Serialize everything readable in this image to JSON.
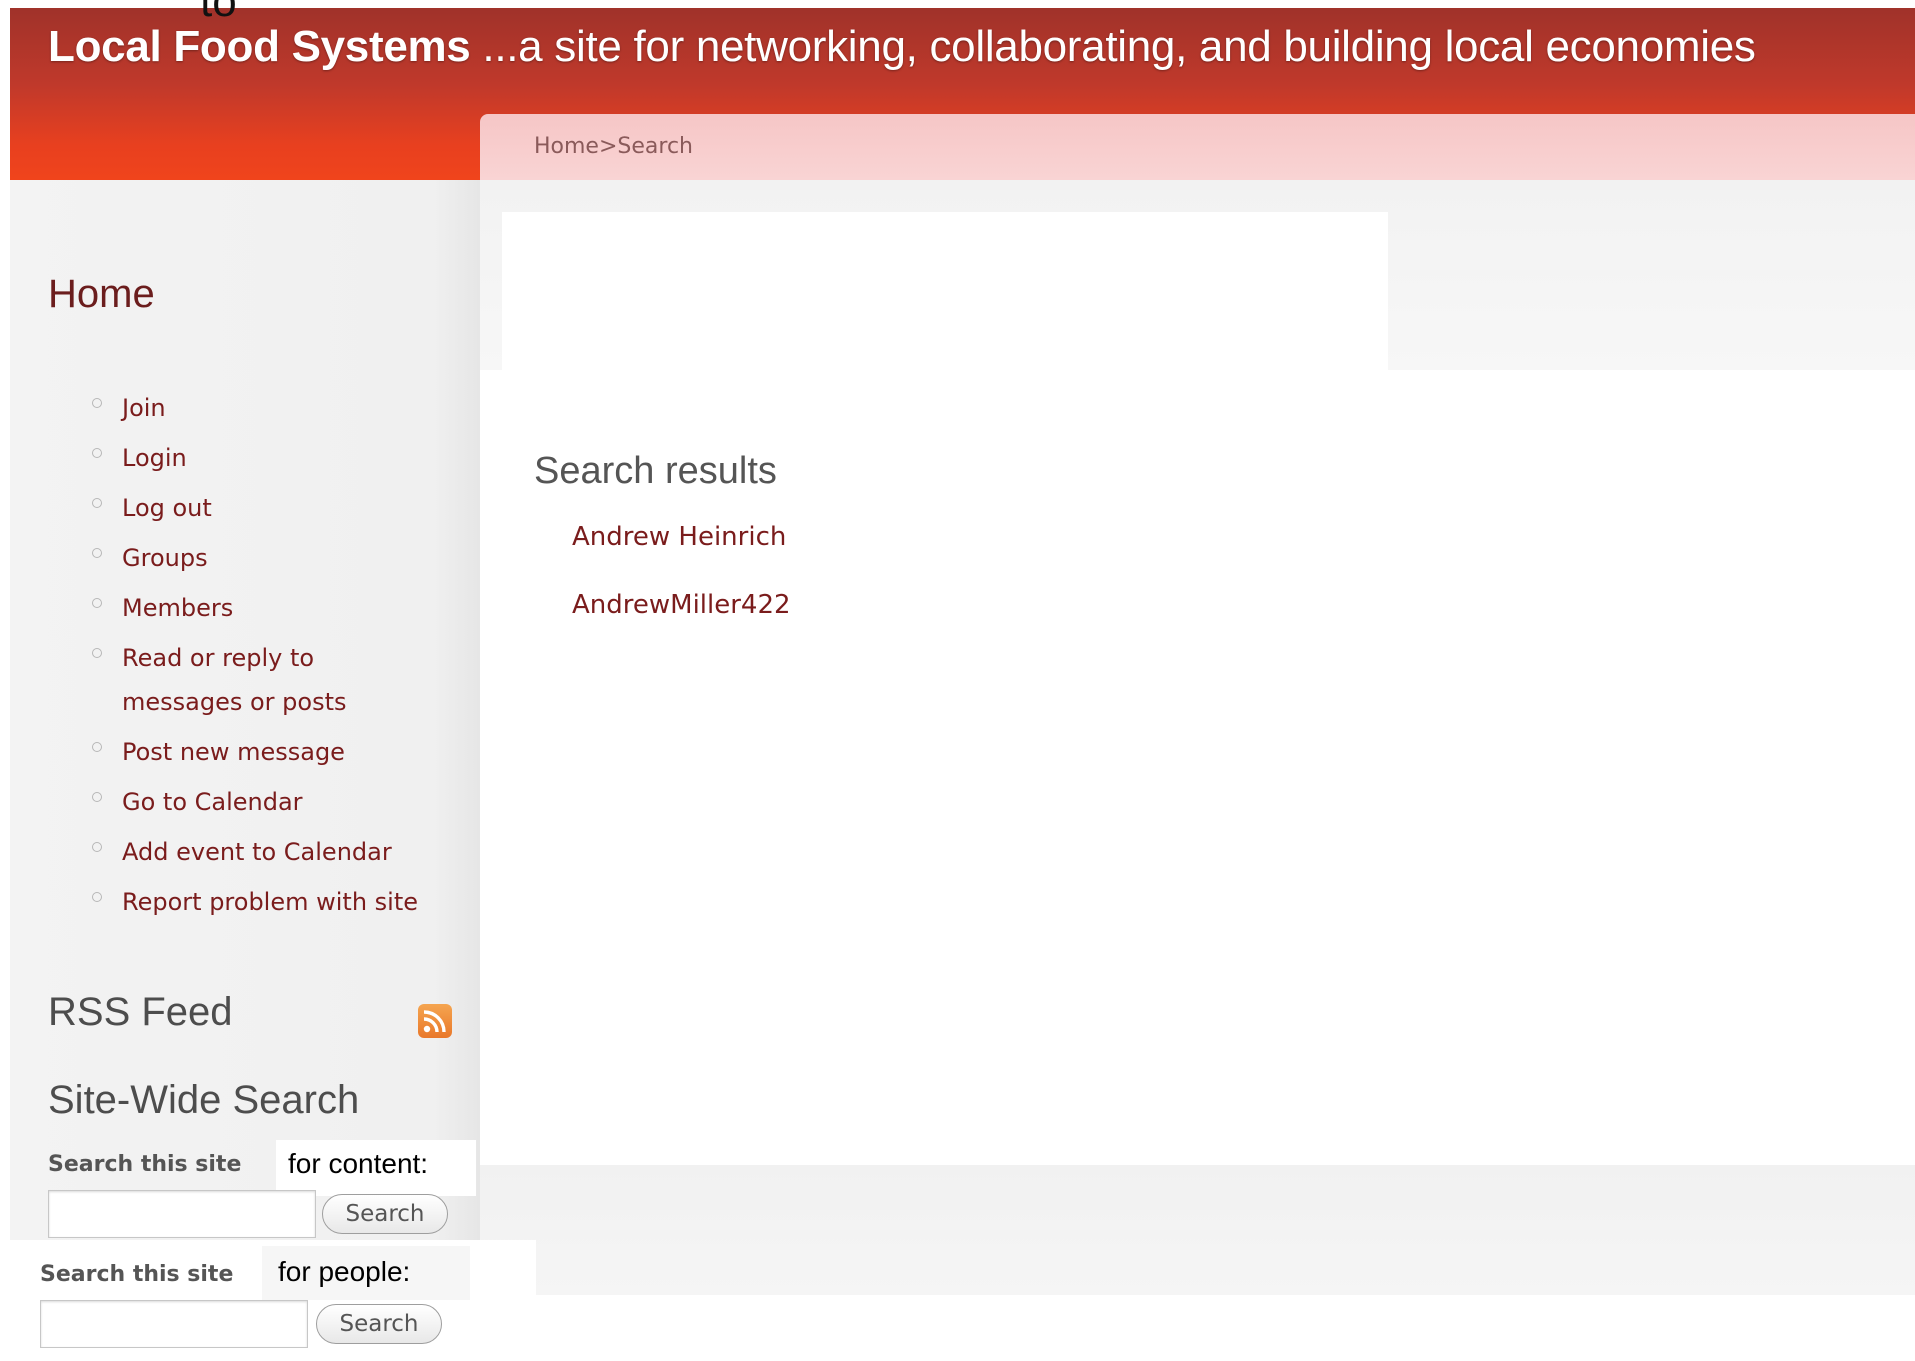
{
  "header": {
    "site_name": "Local Food Systems",
    "tagline": " ...a site for networking, collaborating, and building local economies",
    "top_fragment": "to"
  },
  "breadcrumb": "Home>Search",
  "sidebar": {
    "nav_heading": "Home",
    "nav_items": [
      {
        "label": "Join"
      },
      {
        "label": "Login"
      },
      {
        "label": "Log out"
      },
      {
        "label": "Groups"
      },
      {
        "label": "Members"
      },
      {
        "label": "Read or reply to messages or posts"
      },
      {
        "label": "Post new message"
      },
      {
        "label": "Go to Calendar"
      },
      {
        "label": "Add event to Calendar"
      },
      {
        "label": "Report problem with site"
      }
    ],
    "rss_heading": "RSS Feed",
    "rss_icon": "rss-icon",
    "site_search_heading": "Site-Wide Search",
    "content_search": {
      "label": "Search this site",
      "overlay_text": "for content:",
      "value": "",
      "button_label": "Search"
    },
    "people_search": {
      "label": "Search this site",
      "overlay_text": "for people:",
      "value": "",
      "button_label": "Search"
    }
  },
  "main": {
    "results_heading": "Search results",
    "results": [
      {
        "name": "Andrew Heinrich"
      },
      {
        "name": "AndrewMiller422"
      }
    ]
  },
  "colors": {
    "header_red": "#c0392b",
    "link_maroon": "#7a1c1c",
    "breadcrumb_pink": "#f9d4d4"
  }
}
